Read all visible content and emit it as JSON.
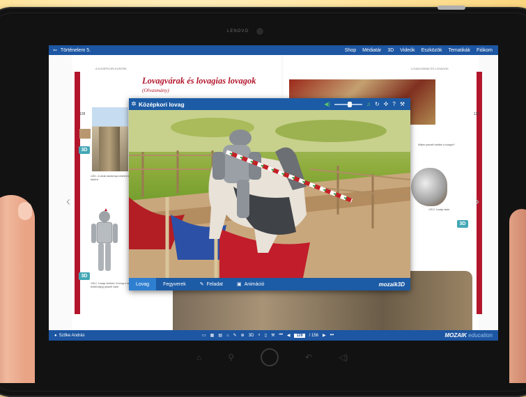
{
  "device": {
    "brand_text": "LENOVO"
  },
  "topbar": {
    "app_title": "Történelem 5.",
    "menu": [
      "Shop",
      "Médiatár",
      "3D",
      "Videók",
      "Eszközök",
      "Tematikák",
      "Fiókom"
    ]
  },
  "book": {
    "left_header": "A KÖZÉPKORI EURÓPA",
    "right_header": "LOVAGVÁRAK ÉS LOVAGOK",
    "title": "Lovagvárak és lovagias lovagok",
    "subtitle": "(Olvasmány)",
    "page_left": "128",
    "page_right": "129",
    "badge_3d": "3D",
    "caption_left_1": "128.1. A várak lakótornya védelmi funkciót látott el",
    "caption_left_2": "128.2. Lovagi vértezet. A lovag a harcban tetőtől talpig páncélt viselt",
    "caption_right_1": "Milyen páncélt viseltek a lovagok?",
    "caption_right_2": "129.3. Lovagi sisak"
  },
  "modal": {
    "title": "Középkori lovag",
    "volume_level": 0.55,
    "tabs": [
      {
        "label": "Lovag",
        "active": true
      },
      {
        "label": "Fegyverek",
        "active": false
      },
      {
        "label": "Feladat",
        "active": false
      },
      {
        "label": "Animáció",
        "active": false
      }
    ],
    "brand": "mozaik3D"
  },
  "bottombar": {
    "user": "Szőke András",
    "current_page": "128",
    "total_pages": "/ 156",
    "brand_main": "MOZAIK",
    "brand_sub": "education"
  },
  "colors": {
    "accent": "#1d56a2",
    "book_red": "#b3162c",
    "badge": "#43a7b5"
  }
}
